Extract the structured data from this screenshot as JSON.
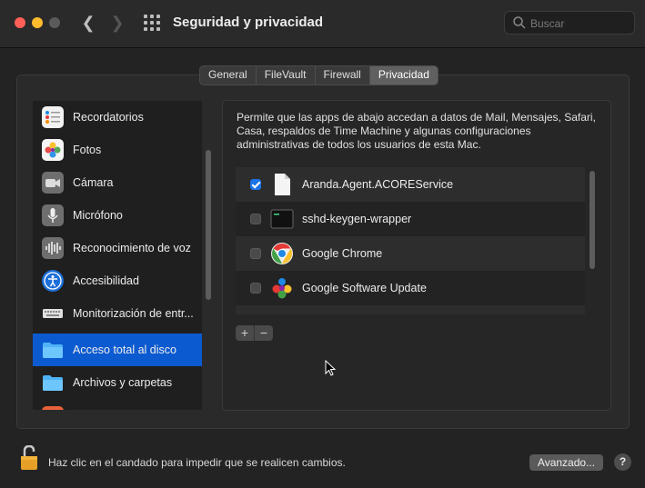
{
  "window": {
    "title": "Seguridad y privacidad"
  },
  "search": {
    "placeholder": "Buscar"
  },
  "tabs": [
    {
      "label": "General",
      "active": false
    },
    {
      "label": "FileVault",
      "active": false
    },
    {
      "label": "Firewall",
      "active": false
    },
    {
      "label": "Privacidad",
      "active": true
    }
  ],
  "sidebar": {
    "items": [
      {
        "label": "Recordatorios",
        "icon": "reminders-icon"
      },
      {
        "label": "Fotos",
        "icon": "photos-icon"
      },
      {
        "label": "Cámara",
        "icon": "camera-icon"
      },
      {
        "label": "Micrófono",
        "icon": "microphone-icon"
      },
      {
        "label": "Reconocimiento de voz",
        "icon": "speech-recognition-icon"
      },
      {
        "label": "Accesibilidad",
        "icon": "accessibility-icon"
      },
      {
        "label": "Monitorización de entr...",
        "icon": "keyboard-icon"
      },
      {
        "label": "Acceso total al disco",
        "icon": "folder-icon",
        "selected": true
      },
      {
        "label": "Archivos y carpetas",
        "icon": "folder-icon"
      }
    ]
  },
  "main": {
    "description": "Permite que las apps de abajo accedan a datos de Mail, Mensajes, Safari, Casa, respaldos de Time Machine y algunas configuraciones administrativas de todos los usuarios de esta Mac.",
    "apps": [
      {
        "name": "Aranda.Agent.ACOREService",
        "checked": true,
        "icon": "document-icon"
      },
      {
        "name": "sshd-keygen-wrapper",
        "checked": false,
        "icon": "terminal-icon"
      },
      {
        "name": "Google Chrome",
        "checked": false,
        "icon": "chrome-icon"
      },
      {
        "name": "Google Software Update",
        "checked": false,
        "icon": "software-update-icon"
      }
    ],
    "add_label": "+",
    "remove_label": "−"
  },
  "footer": {
    "lock_text": "Haz clic en el candado para impedir que se realicen cambios.",
    "advanced_label": "Avanzado...",
    "help_label": "?"
  },
  "colors": {
    "accent": "#0c5ad0",
    "checkbox": "#1a73e8"
  }
}
